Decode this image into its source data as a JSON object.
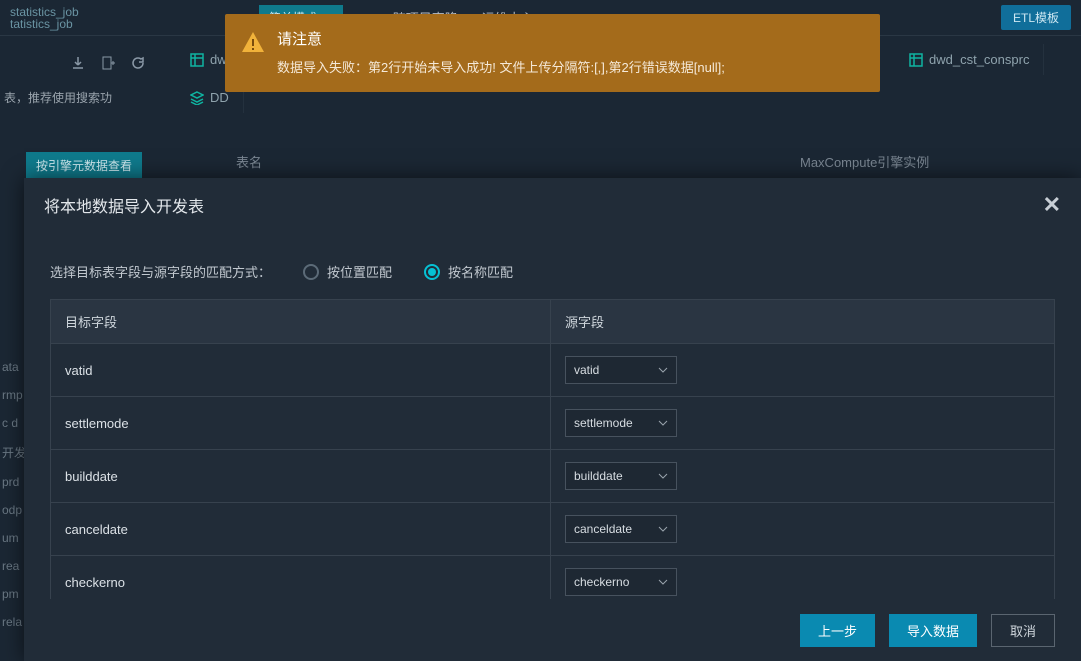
{
  "crumbs": {
    "line1": "statistics_job",
    "line2": "tatistics_job"
  },
  "mode_btn": "简单模式",
  "top_menu": {
    "clone": "跨项目克隆",
    "ops": "运维中心"
  },
  "etl_btn": "ETL模板",
  "hint": "表，推荐使用搜索功",
  "engine_btn": "按引擎元数据查看",
  "tabs": {
    "t1": "dw",
    "t1b": "DD",
    "far": "dwd_cst_consprc"
  },
  "table_head": {
    "name": "表名",
    "engine": "MaxCompute引擎实例"
  },
  "side_items": [
    "ata",
    "rmp",
    "c  d",
    "开发",
    "prd",
    "odp",
    "um",
    "rea",
    "pm",
    "rela"
  ],
  "alert": {
    "title": "请注意",
    "body": "数据导入失败：第2行开始未导入成功! 文件上传分隔符:[,],第2行错误数据[null];"
  },
  "modal": {
    "title": "将本地数据导入开发表",
    "match_label": "选择目标表字段与源字段的匹配方式：",
    "radio_pos": "按位置匹配",
    "radio_name": "按名称匹配",
    "col1": "目标字段",
    "col2": "源字段",
    "rows": [
      {
        "target": "vatid",
        "source": "vatid"
      },
      {
        "target": "settlemode",
        "source": "settlemode"
      },
      {
        "target": "builddate",
        "source": "builddate"
      },
      {
        "target": "canceldate",
        "source": "canceldate"
      },
      {
        "target": "checkerno",
        "source": "checkerno"
      }
    ],
    "prev": "上一步",
    "import": "导入数据",
    "cancel": "取消"
  }
}
